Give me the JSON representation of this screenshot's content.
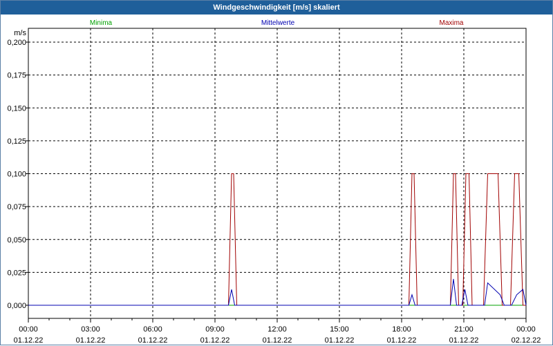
{
  "window": {
    "title": "Windgeschwindigkeit [m/s] skaliert"
  },
  "colors": {
    "minima": "#00a000",
    "mittelwerte": "#0000b0",
    "maxima": "#a00000"
  },
  "chart_data": {
    "type": "line",
    "title": "Windgeschwindigkeit [m/s] skaliert",
    "ylabel": "m/s",
    "ylim": [
      0,
      0.2
    ],
    "y_ticks": [
      "0,000",
      "0,025",
      "0,050",
      "0,075",
      "0,100",
      "0,125",
      "0,150",
      "0,175",
      "0,200"
    ],
    "x_ticks": [
      {
        "time": "00:00",
        "date": "01.12.22"
      },
      {
        "time": "03:00",
        "date": "01.12.22"
      },
      {
        "time": "06:00",
        "date": "01.12.22"
      },
      {
        "time": "09:00",
        "date": "01.12.22"
      },
      {
        "time": "12:00",
        "date": "01.12.22"
      },
      {
        "time": "15:00",
        "date": "01.12.22"
      },
      {
        "time": "18:00",
        "date": "01.12.22"
      },
      {
        "time": "21:00",
        "date": "01.12.22"
      },
      {
        "time": "00:00",
        "date": "02.12.22"
      }
    ],
    "xlim_hours": [
      0,
      24
    ],
    "grid": true,
    "legend_placement": "top",
    "series": [
      {
        "name": "Minima",
        "x": [
          0,
          24
        ],
        "values": [
          0,
          0
        ]
      },
      {
        "name": "Mittelwerte",
        "x": [
          0,
          9.65,
          9.8,
          9.95,
          18.35,
          18.5,
          18.65,
          20.35,
          20.5,
          20.65,
          20.9,
          21.05,
          21.2,
          21.35,
          22.0,
          22.15,
          22.75,
          22.95,
          23.3,
          23.55,
          23.85,
          24
        ],
        "values": [
          0,
          0,
          0.012,
          0,
          0,
          0.008,
          0,
          0,
          0.02,
          0,
          0,
          0.012,
          0,
          0,
          0,
          0.017,
          0.008,
          0,
          0,
          0.008,
          0.012,
          0
        ]
      },
      {
        "name": "Maxima",
        "x": [
          0,
          9.65,
          9.8,
          9.9,
          10.05,
          18.35,
          18.5,
          18.6,
          18.75,
          20.35,
          20.5,
          20.6,
          20.75,
          20.95,
          21.1,
          21.25,
          21.4,
          21.95,
          22.15,
          22.65,
          22.85,
          23.25,
          23.45,
          23.65,
          23.85,
          24
        ],
        "values": [
          0,
          0,
          0.1,
          0.1,
          0,
          0,
          0.1,
          0.1,
          0,
          0,
          0.1,
          0.1,
          0,
          0,
          0.1,
          0.1,
          0,
          0,
          0.1,
          0.1,
          0,
          0,
          0.1,
          0.1,
          0,
          0
        ]
      }
    ]
  }
}
